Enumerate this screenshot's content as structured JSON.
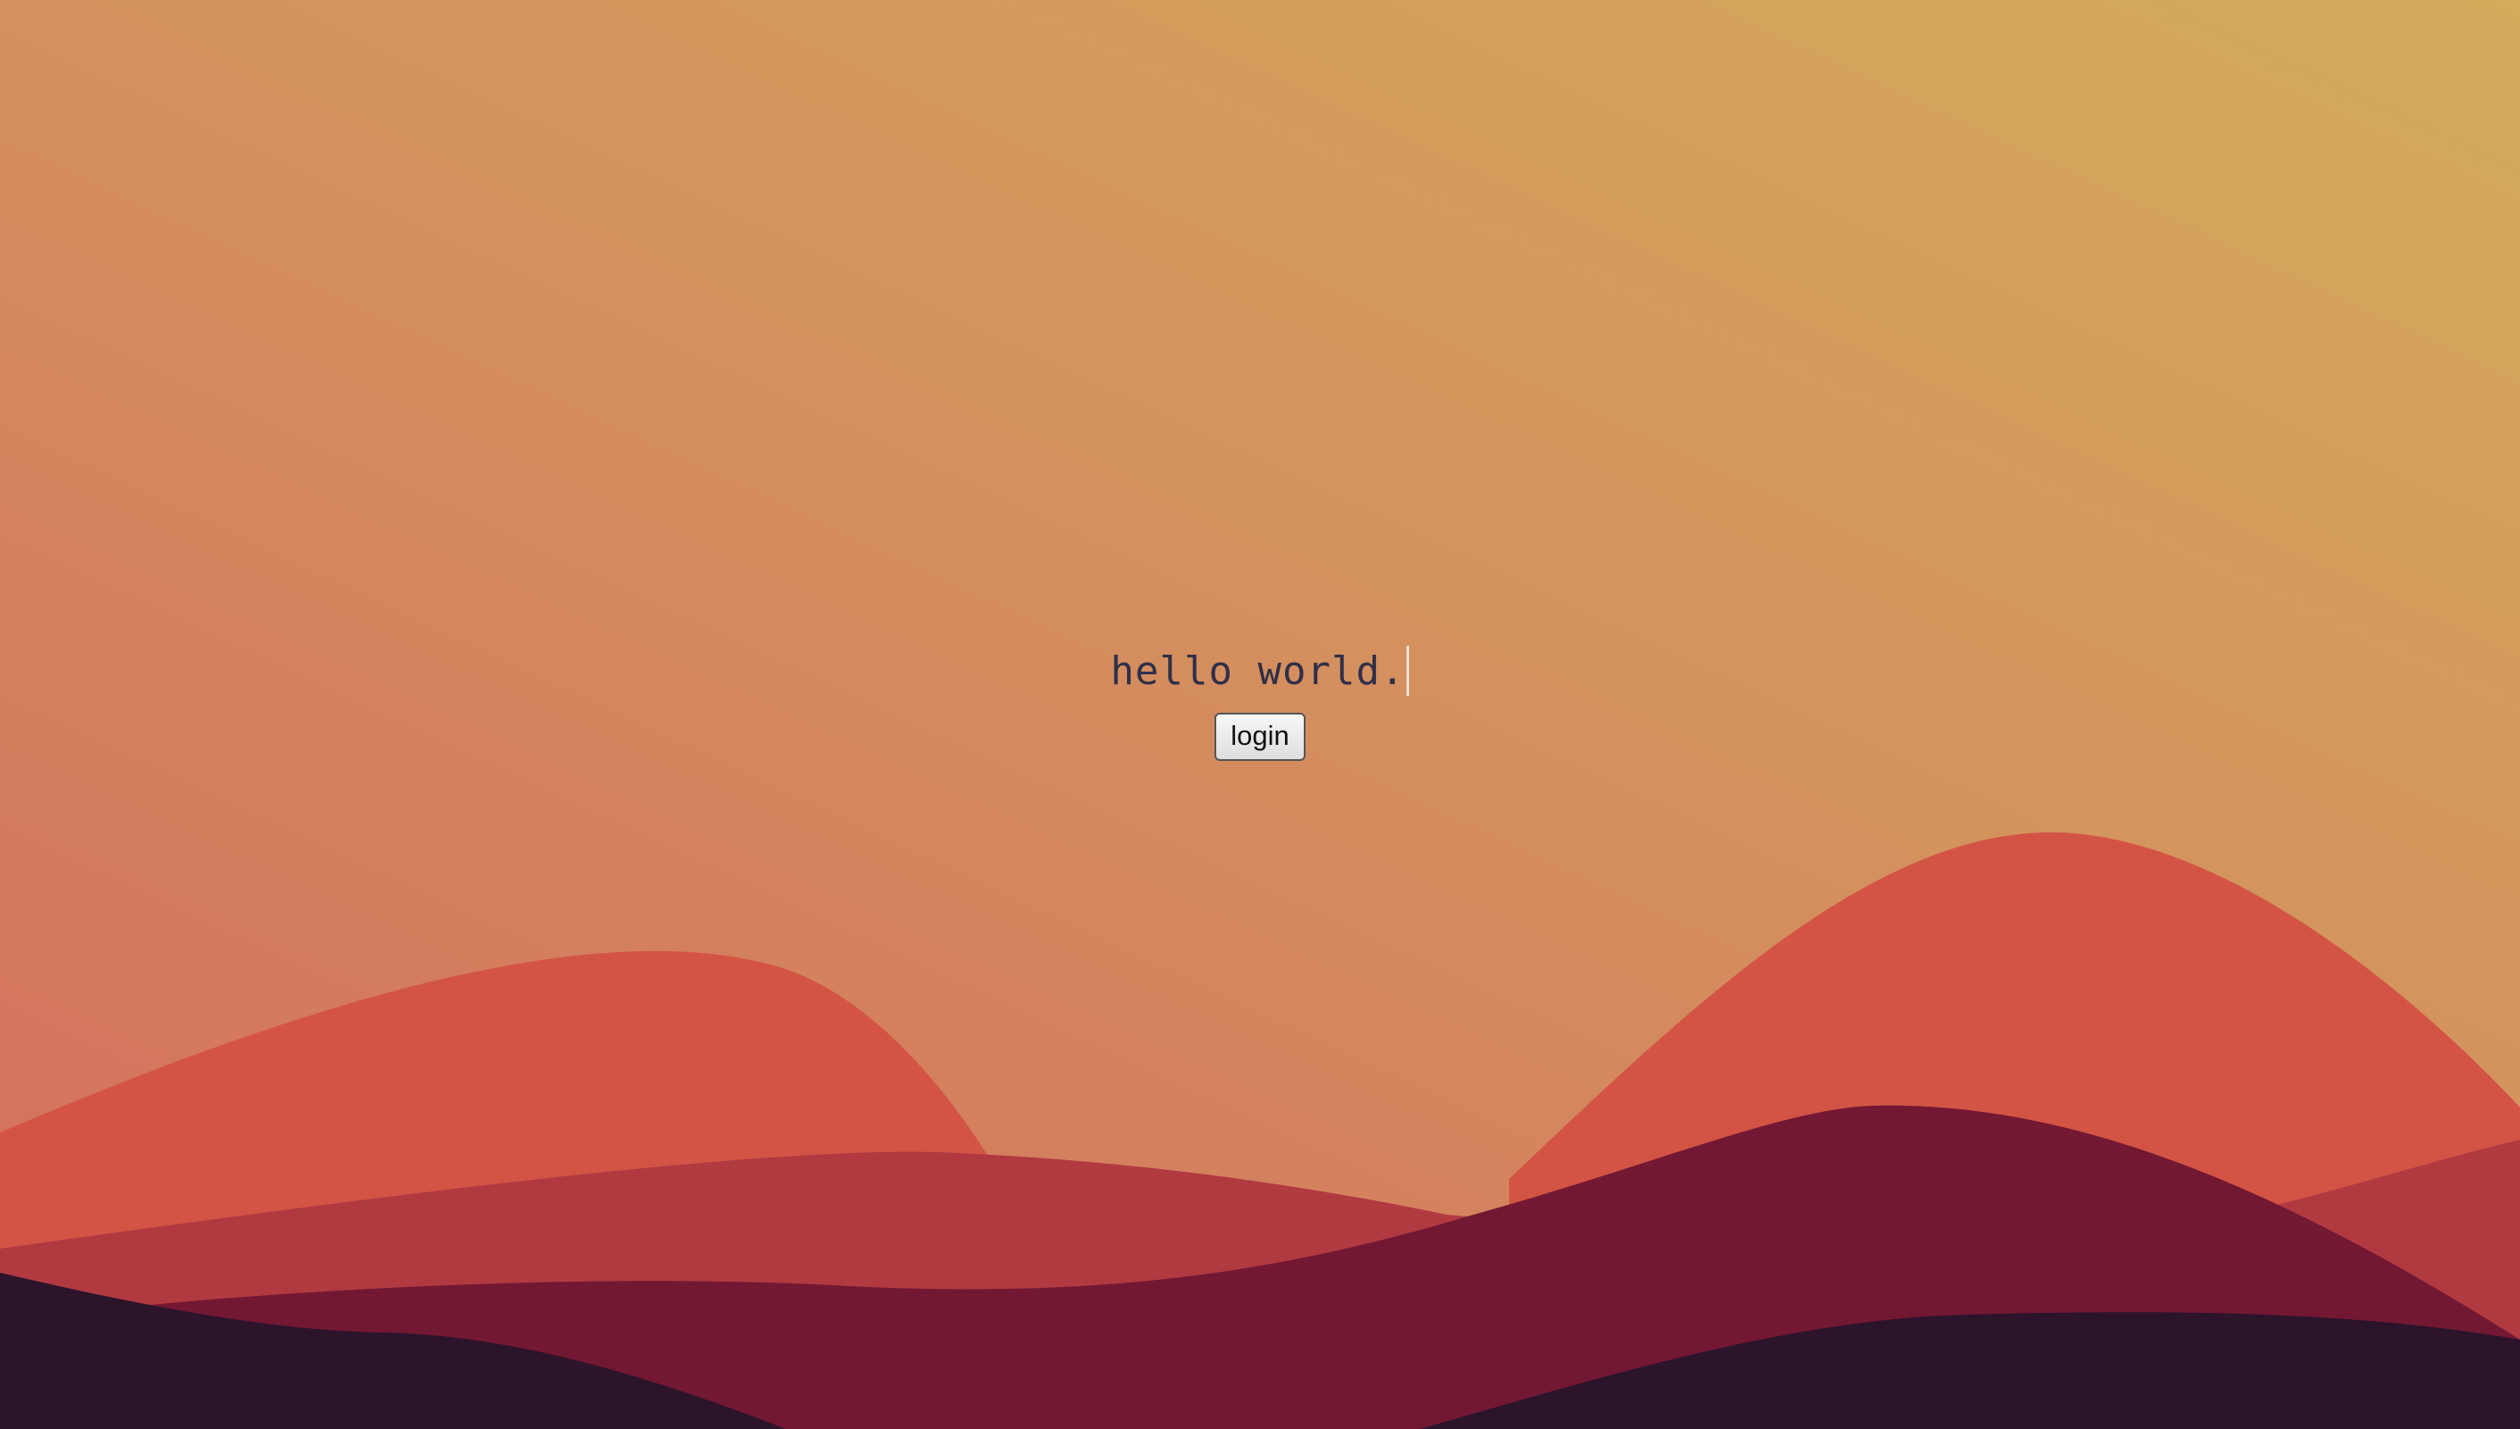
{
  "page": {
    "headline": "hello world.",
    "login_label": "login"
  },
  "colors": {
    "sky_top_right": "#d3ab5b",
    "sky_bottom_left": "#d46c5f",
    "hill_coral": "#d35445",
    "hill_crimson": "#b13a41",
    "hill_maroon": "#731833",
    "hill_plum": "#2c142b",
    "headline_text": "#2f2f4a",
    "caret": "#f4e3cf"
  }
}
